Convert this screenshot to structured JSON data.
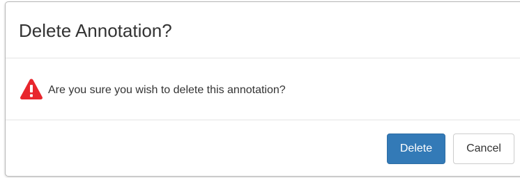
{
  "dialog": {
    "title": "Delete Annotation?",
    "message": "Are you sure you wish to delete this annotation?",
    "icon": "warning-icon",
    "colors": {
      "warning": "#e8262d",
      "primary": "#337ab7"
    }
  },
  "footer": {
    "delete_label": "Delete",
    "cancel_label": "Cancel"
  }
}
